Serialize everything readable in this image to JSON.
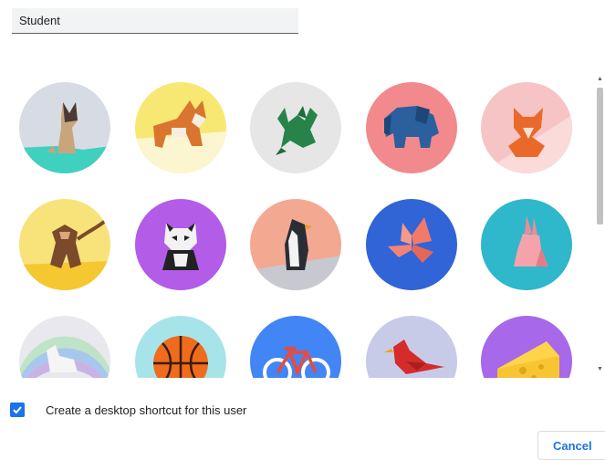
{
  "profile_name": {
    "value": "Student"
  },
  "avatars": [
    {
      "name": "origami-cat",
      "bg": "#d6dbe4"
    },
    {
      "name": "origami-corgi",
      "bg": "#f6e873"
    },
    {
      "name": "origami-dragon",
      "bg": "#e5e6e5"
    },
    {
      "name": "origami-elephant",
      "bg": "#f2898c"
    },
    {
      "name": "origami-fox",
      "bg": "#f7c4c5"
    },
    {
      "name": "origami-monkey",
      "bg": "#f8e27a"
    },
    {
      "name": "origami-panda",
      "bg": "#b25ce8"
    },
    {
      "name": "origami-penguin",
      "bg": "#f3a892"
    },
    {
      "name": "origami-butterfly",
      "bg": "#3164d6"
    },
    {
      "name": "origami-rabbit",
      "bg": "#2fb7cc"
    },
    {
      "name": "origami-unicorn",
      "bg": "#e8e8ee"
    },
    {
      "name": "basketball",
      "bg": "#a7e4ea"
    },
    {
      "name": "bike",
      "bg": "#4285f4"
    },
    {
      "name": "origami-bird",
      "bg": "#c7cbe8"
    },
    {
      "name": "cheese",
      "bg": "#a768ea"
    }
  ],
  "shortcut": {
    "checked": true,
    "label": "Create a desktop shortcut for this user"
  },
  "cancel_label": "Cancel",
  "colors": {
    "accent": "#1a73e8",
    "field_bg": "#f1f3f4"
  }
}
